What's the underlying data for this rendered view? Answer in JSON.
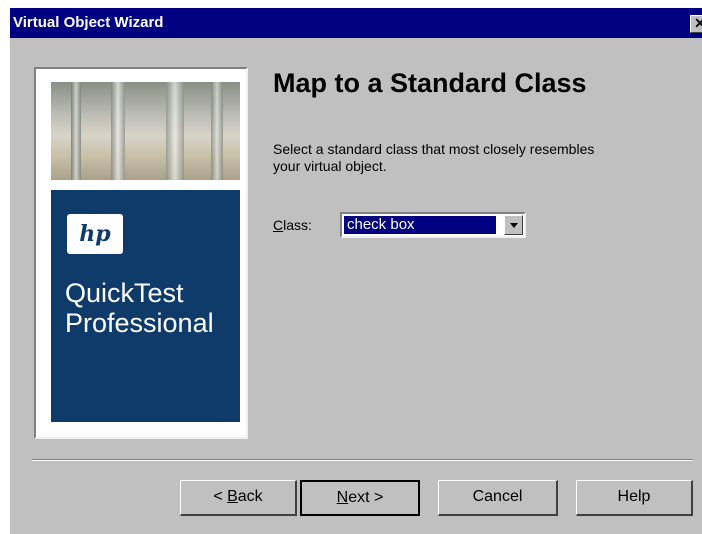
{
  "window": {
    "title": "Virtual Object Wizard",
    "close_glyph": "✕"
  },
  "sidebar": {
    "logo_text": "hp",
    "product_line1": "QuickTest",
    "product_line2": "Professional",
    "brand_color": "#0f3b6b"
  },
  "page": {
    "heading": "Map to a Standard Class",
    "description": "Select a standard class that most closely resembles your virtual object.",
    "class_label": "Class:",
    "class_value": "check box"
  },
  "buttons": {
    "back": "< Back",
    "next": "Next >",
    "cancel": "Cancel",
    "help": "Help"
  },
  "colors": {
    "titlebar": "#000080",
    "dialog": "#c0c0c0"
  }
}
